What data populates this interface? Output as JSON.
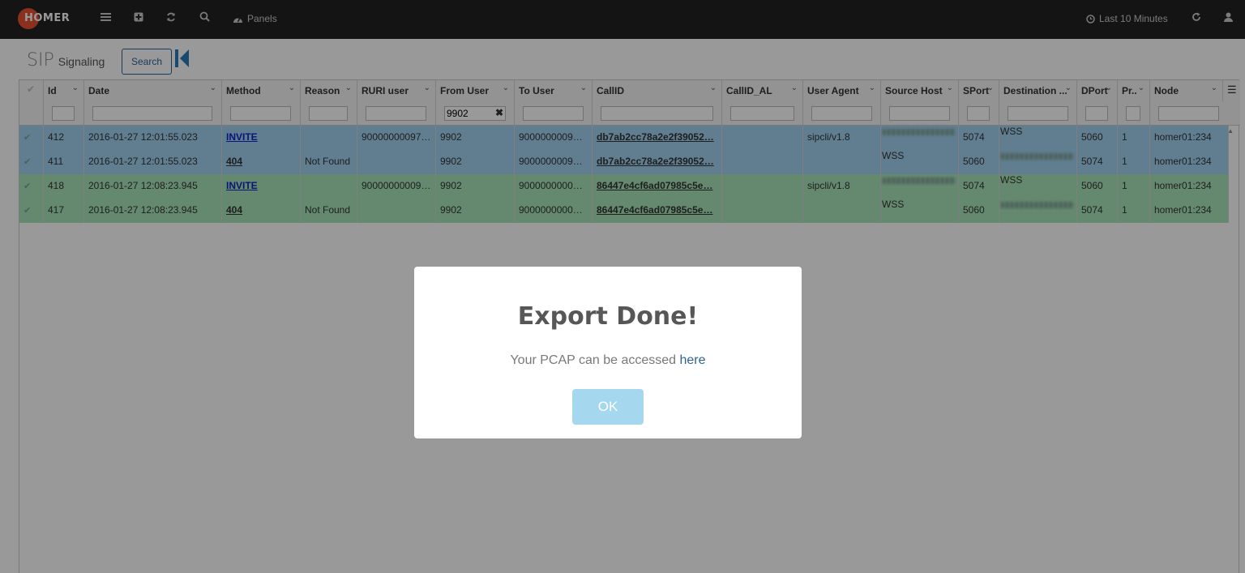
{
  "navbar": {
    "logo_text": "HOMER",
    "panels_label": "Panels",
    "time_range": "Last 10 Minutes"
  },
  "panel": {
    "title_big": "SIP",
    "title_small": "Signaling",
    "search_label": "Search"
  },
  "grid": {
    "columns": [
      {
        "label": "Id",
        "filter": ""
      },
      {
        "label": "Date",
        "filter": ""
      },
      {
        "label": "Method",
        "filter": ""
      },
      {
        "label": "Reason",
        "filter": ""
      },
      {
        "label": "RURI user",
        "filter": ""
      },
      {
        "label": "From User",
        "filter": "9902"
      },
      {
        "label": "To User",
        "filter": ""
      },
      {
        "label": "CallID",
        "filter": ""
      },
      {
        "label": "CallID_AL",
        "filter": ""
      },
      {
        "label": "User Agent",
        "filter": ""
      },
      {
        "label": "Source Host",
        "filter": ""
      },
      {
        "label": "SPort",
        "filter": ""
      },
      {
        "label": "Destination ...",
        "filter": ""
      },
      {
        "label": "DPort",
        "filter": ""
      },
      {
        "label": "Pr..",
        "filter": ""
      },
      {
        "label": "Node",
        "filter": ""
      }
    ],
    "rows": [
      {
        "id": "412",
        "date": "2016-01-27 12:01:55.023",
        "method": "INVITE",
        "reason": "",
        "ruri": "90000000097…",
        "from": "9902",
        "to": "9000000009…",
        "callid": "db7ab2cc78a2e2f39052…",
        "callid_al": "",
        "ua": "sipcli/v1.8",
        "src": "",
        "sport": "5074",
        "dst": "WSS",
        "dport": "5060",
        "proto": "1",
        "node": "homer01:234"
      },
      {
        "id": "411",
        "date": "2016-01-27 12:01:55.023",
        "method": "404",
        "reason": "Not Found",
        "ruri": "",
        "from": "9902",
        "to": "9000000009…",
        "callid": "db7ab2cc78a2e2f39052…",
        "callid_al": "",
        "ua": "",
        "src": "WSS",
        "sport": "5060",
        "dst": "",
        "dport": "5074",
        "proto": "1",
        "node": "homer01:234"
      },
      {
        "id": "418",
        "date": "2016-01-27 12:08:23.945",
        "method": "INVITE",
        "reason": "",
        "ruri": "90000000009…",
        "from": "9902",
        "to": "9000000000…",
        "callid": "86447e4cf6ad07985c5e…",
        "callid_al": "",
        "ua": "sipcli/v1.8",
        "src": "",
        "sport": "5074",
        "dst": "WSS",
        "dport": "5060",
        "proto": "1",
        "node": "homer01:234"
      },
      {
        "id": "417",
        "date": "2016-01-27 12:08:23.945",
        "method": "404",
        "reason": "Not Found",
        "ruri": "",
        "from": "9902",
        "to": "9000000000…",
        "callid": "86447e4cf6ad07985c5e…",
        "callid_al": "",
        "ua": "",
        "src": "WSS",
        "sport": "5060",
        "dst": "",
        "dport": "5074",
        "proto": "1",
        "node": "homer01:234"
      }
    ]
  },
  "modal": {
    "title": "Export Done!",
    "text": "Your PCAP can be accessed",
    "link_text": "here",
    "ok_label": "OK"
  },
  "colors": {
    "navbar_bg": "#222222",
    "row_blue": "#a0d2f0",
    "row_green": "#a9e5b9",
    "ok_button": "#a5d8ef",
    "logo": "#e8512f"
  }
}
